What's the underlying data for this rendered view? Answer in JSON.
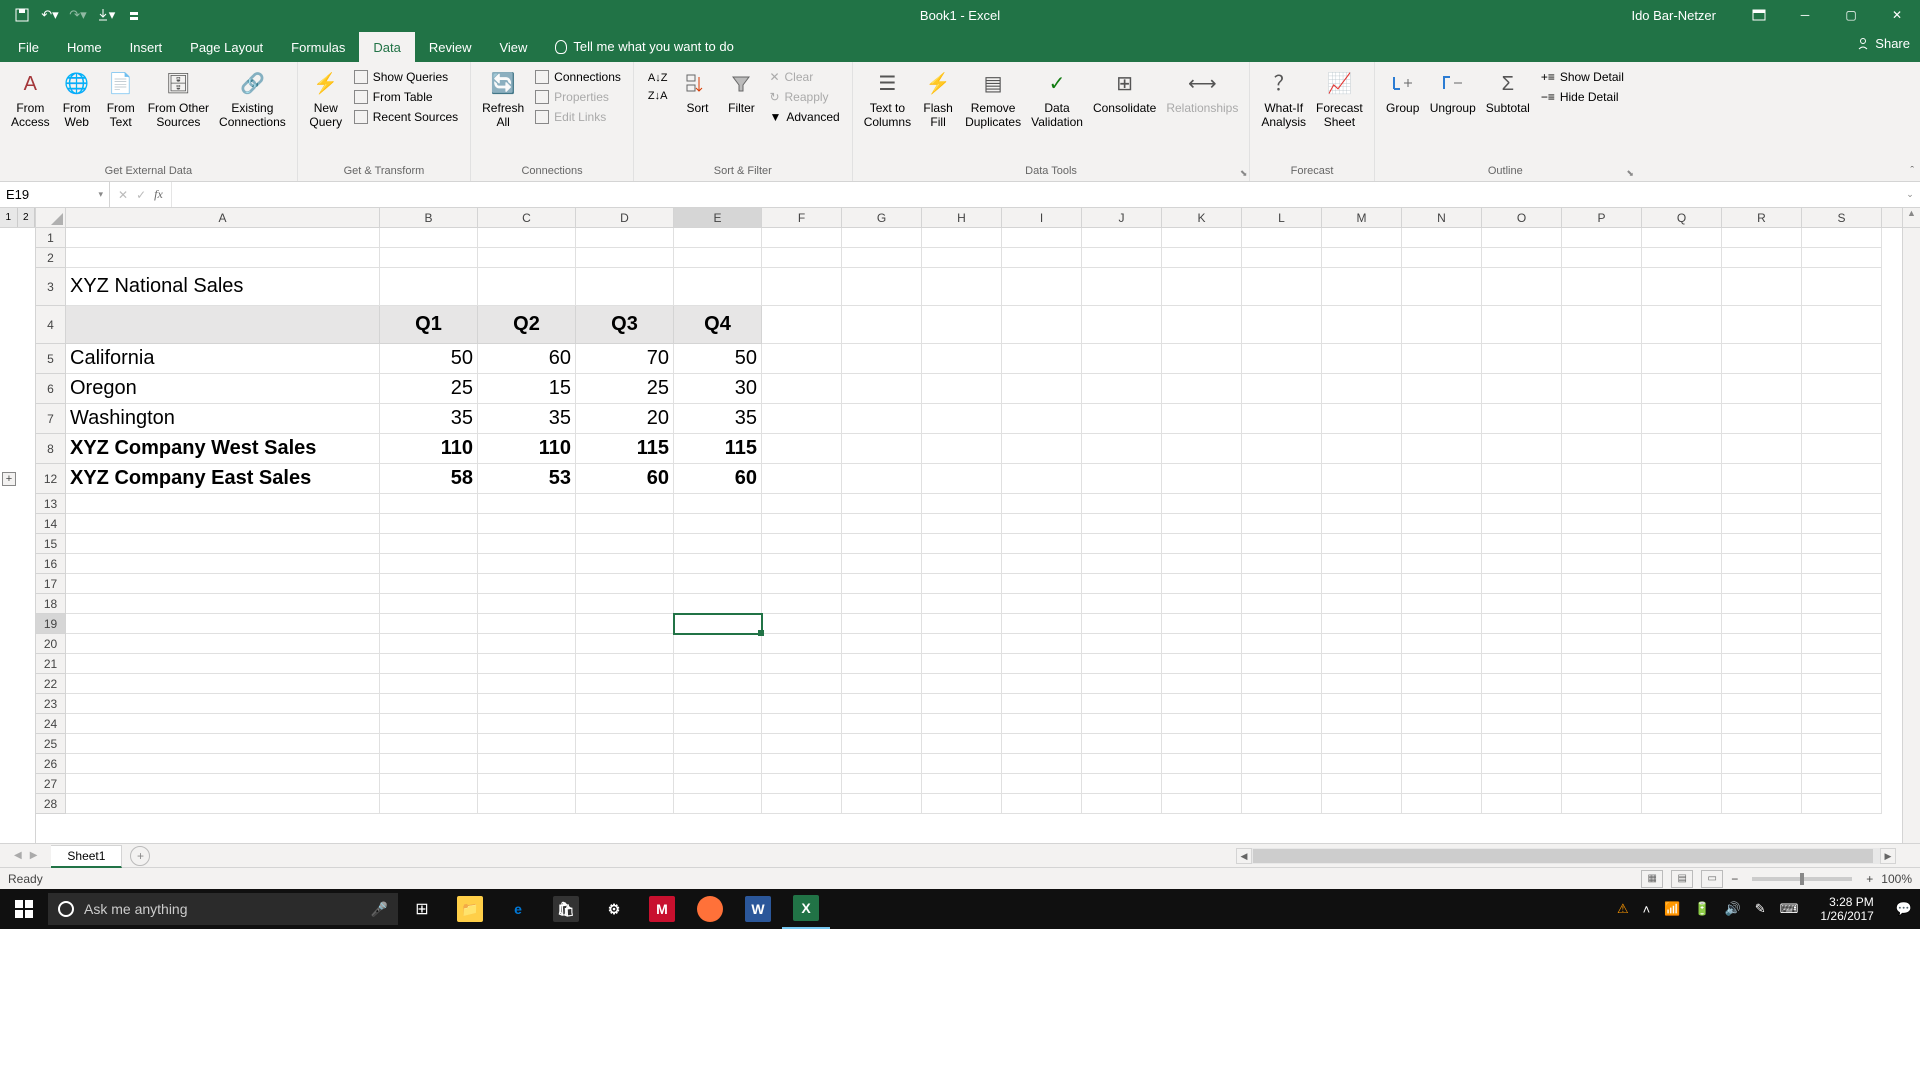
{
  "title": "Book1 - Excel",
  "user": "Ido Bar-Netzer",
  "tabs": [
    "File",
    "Home",
    "Insert",
    "Page Layout",
    "Formulas",
    "Data",
    "Review",
    "View"
  ],
  "active_tab": "Data",
  "tellme_placeholder": "Tell me what you want to do",
  "share_label": "Share",
  "ribbon": {
    "groups": [
      {
        "label": "Get External Data",
        "items": [
          "From\nAccess",
          "From\nWeb",
          "From\nText",
          "From Other\nSources",
          "Existing\nConnections"
        ]
      },
      {
        "label": "Get & Transform",
        "big": "New\nQuery",
        "small": [
          "Show Queries",
          "From Table",
          "Recent Sources"
        ]
      },
      {
        "label": "Connections",
        "big": "Refresh\nAll",
        "small": [
          "Connections",
          "Properties",
          "Edit Links"
        ]
      },
      {
        "label": "Sort & Filter",
        "sort": "Sort",
        "filter": "Filter",
        "small": [
          "Clear",
          "Reapply",
          "Advanced"
        ]
      },
      {
        "label": "Data Tools",
        "items": [
          "Text to\nColumns",
          "Flash\nFill",
          "Remove\nDuplicates",
          "Data\nValidation",
          "Consolidate",
          "Relationships"
        ]
      },
      {
        "label": "Forecast",
        "items": [
          "What-If\nAnalysis",
          "Forecast\nSheet"
        ]
      },
      {
        "label": "Outline",
        "items": [
          "Group",
          "Ungroup",
          "Subtotal"
        ],
        "side": [
          "Show Detail",
          "Hide Detail"
        ]
      }
    ]
  },
  "name_box": "E19",
  "formula_bar": "",
  "columns": [
    "A",
    "B",
    "C",
    "D",
    "E",
    "F",
    "G",
    "H",
    "I",
    "J",
    "K",
    "L",
    "M",
    "N",
    "O",
    "P",
    "Q",
    "R",
    "S"
  ],
  "col_widths": {
    "A": 314,
    "B": 98,
    "C": 98,
    "D": 98,
    "E": 88,
    "default": 80
  },
  "selected": {
    "col": "E",
    "row": 19
  },
  "chart_data": {
    "type": "table",
    "title": "XYZ National Sales",
    "categories": [
      "Q1",
      "Q2",
      "Q3",
      "Q4"
    ],
    "series": [
      {
        "name": "California",
        "values": [
          50,
          60,
          70,
          50
        ]
      },
      {
        "name": "Oregon",
        "values": [
          25,
          15,
          25,
          30
        ]
      },
      {
        "name": "Washington",
        "values": [
          35,
          35,
          20,
          35
        ]
      },
      {
        "name": "XYZ Company West Sales",
        "values": [
          110,
          110,
          115,
          115
        ],
        "bold": true
      },
      {
        "name": "XYZ Company East Sales",
        "values": [
          58,
          53,
          60,
          60
        ],
        "bold": true,
        "row_num": 12
      }
    ]
  },
  "visible_rows": [
    1,
    2,
    3,
    4,
    5,
    6,
    7,
    8,
    12,
    13,
    14,
    15,
    16,
    17,
    18,
    19,
    20,
    21,
    22,
    23,
    24,
    25,
    26,
    27,
    28
  ],
  "sheet_name": "Sheet1",
  "status": "Ready",
  "zoom": "100%",
  "taskbar": {
    "search_placeholder": "Ask me anything",
    "time": "3:28 PM",
    "date": "1/26/2017"
  }
}
